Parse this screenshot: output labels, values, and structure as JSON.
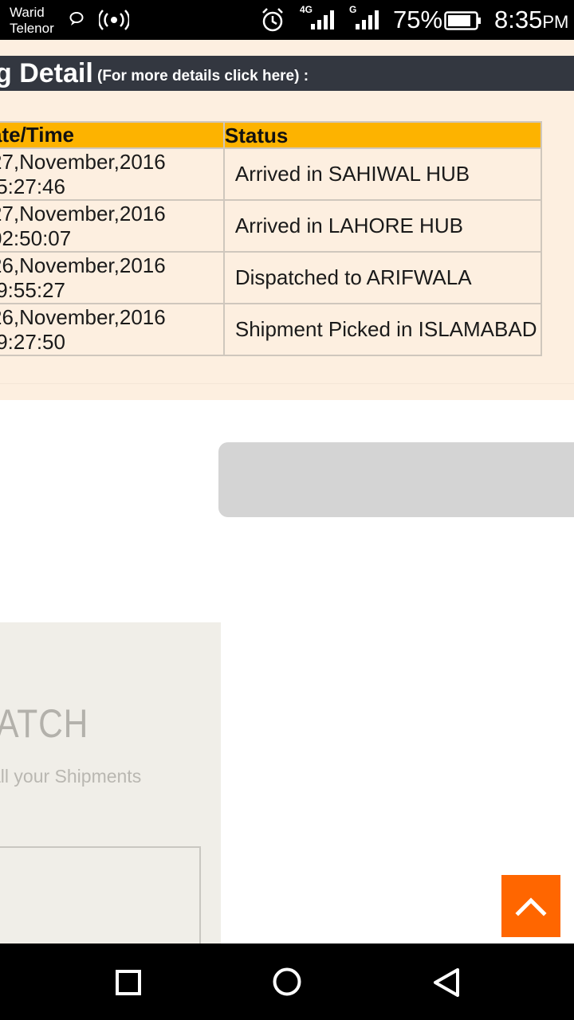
{
  "status_bar": {
    "carrier_line1": "Warid",
    "carrier_line2": "Telenor",
    "net_label_1": "4G",
    "net_label_2": "G",
    "battery": "75%",
    "time": "8:35",
    "ampm": "PM"
  },
  "tracking": {
    "title": "g Detail",
    "subtitle": "(For more details click here) :",
    "columns": [
      "ate/Time",
      "Status"
    ],
    "rows": [
      {
        "date": "27,November,2016",
        "time": " 5:27:46",
        "status": "Arrived in SAHIWAL HUB"
      },
      {
        "date": "27,November,2016",
        "time": "02:50:07",
        "status": "Arrived in LAHORE HUB"
      },
      {
        "date": "26,November,2016",
        "time": " 9:55:27",
        "status": "Dispatched to ARIFWALA"
      },
      {
        "date": "26,November,2016",
        "time": " 9:27:50",
        "status": "Shipment Picked in ISLAMABAD"
      }
    ]
  },
  "promo": {
    "heading": "SPATCH",
    "tagline": "all your Shipments"
  },
  "icons": {
    "chat": "chat-bubble-icon",
    "hotspot": "hotspot-icon",
    "alarm": "alarm-icon",
    "signal": "signal-bars-icon",
    "battery": "battery-icon",
    "scroll_top": "chevron-up-icon",
    "nav_recent": "square-icon",
    "nav_home": "circle-icon",
    "nav_back": "triangle-back-icon"
  },
  "colors": {
    "title_bar": "#333740",
    "table_header": "#fdb300",
    "row_bg": "#fdefe0",
    "scroll_button": "#ff6600"
  }
}
